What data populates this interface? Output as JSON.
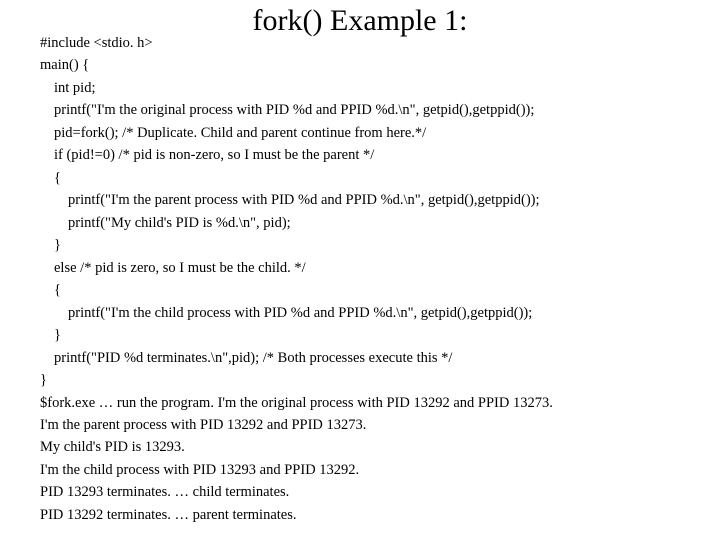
{
  "title": "fork() Example 1:",
  "lines": [
    {
      "indent": 0,
      "text": "#include <stdio. h>"
    },
    {
      "indent": 0,
      "text": "main() {"
    },
    {
      "indent": 1,
      "text": "int pid;"
    },
    {
      "indent": 1,
      "text": "printf(\"I'm the original process with PID %d and PPID %d.\\n\", getpid(),getppid());"
    },
    {
      "indent": 1,
      "text": "pid=fork(); /* Duplicate. Child and parent continue from here.*/"
    },
    {
      "indent": 1,
      "text": "if (pid!=0) /* pid is non-zero, so I must be the parent */"
    },
    {
      "indent": 1,
      "text": "{"
    },
    {
      "indent": 2,
      "text": "printf(\"I'm the parent process with PID %d and PPID %d.\\n\", getpid(),getppid());"
    },
    {
      "indent": 2,
      "text": "printf(\"My child's PID is %d.\\n\", pid);"
    },
    {
      "indent": 1,
      "text": "}"
    },
    {
      "indent": 1,
      "text": "else /* pid is zero, so I must be the child. */"
    },
    {
      "indent": 1,
      "text": "{"
    },
    {
      "indent": 2,
      "text": "printf(\"I'm the child process with PID %d and PPID %d.\\n\", getpid(),getppid());"
    },
    {
      "indent": 1,
      "text": "}"
    },
    {
      "indent": 1,
      "text": "printf(\"PID %d terminates.\\n\",pid); /* Both processes execute this */"
    },
    {
      "indent": 0,
      "text": "}"
    },
    {
      "indent": 0,
      "text": "$fork.exe … run the program. I'm the original process with PID 13292 and PPID 13273."
    },
    {
      "indent": 0,
      "text": "I'm the parent process with PID 13292 and PPID 13273."
    },
    {
      "indent": 0,
      "text": "My child's PID is 13293."
    },
    {
      "indent": 0,
      "text": "I'm the child process with PID 13293 and PPID 13292."
    },
    {
      "indent": 0,
      "text": "PID 13293 terminates. … child terminates."
    },
    {
      "indent": 0,
      "text": "PID 13292 terminates. … parent terminates."
    }
  ]
}
